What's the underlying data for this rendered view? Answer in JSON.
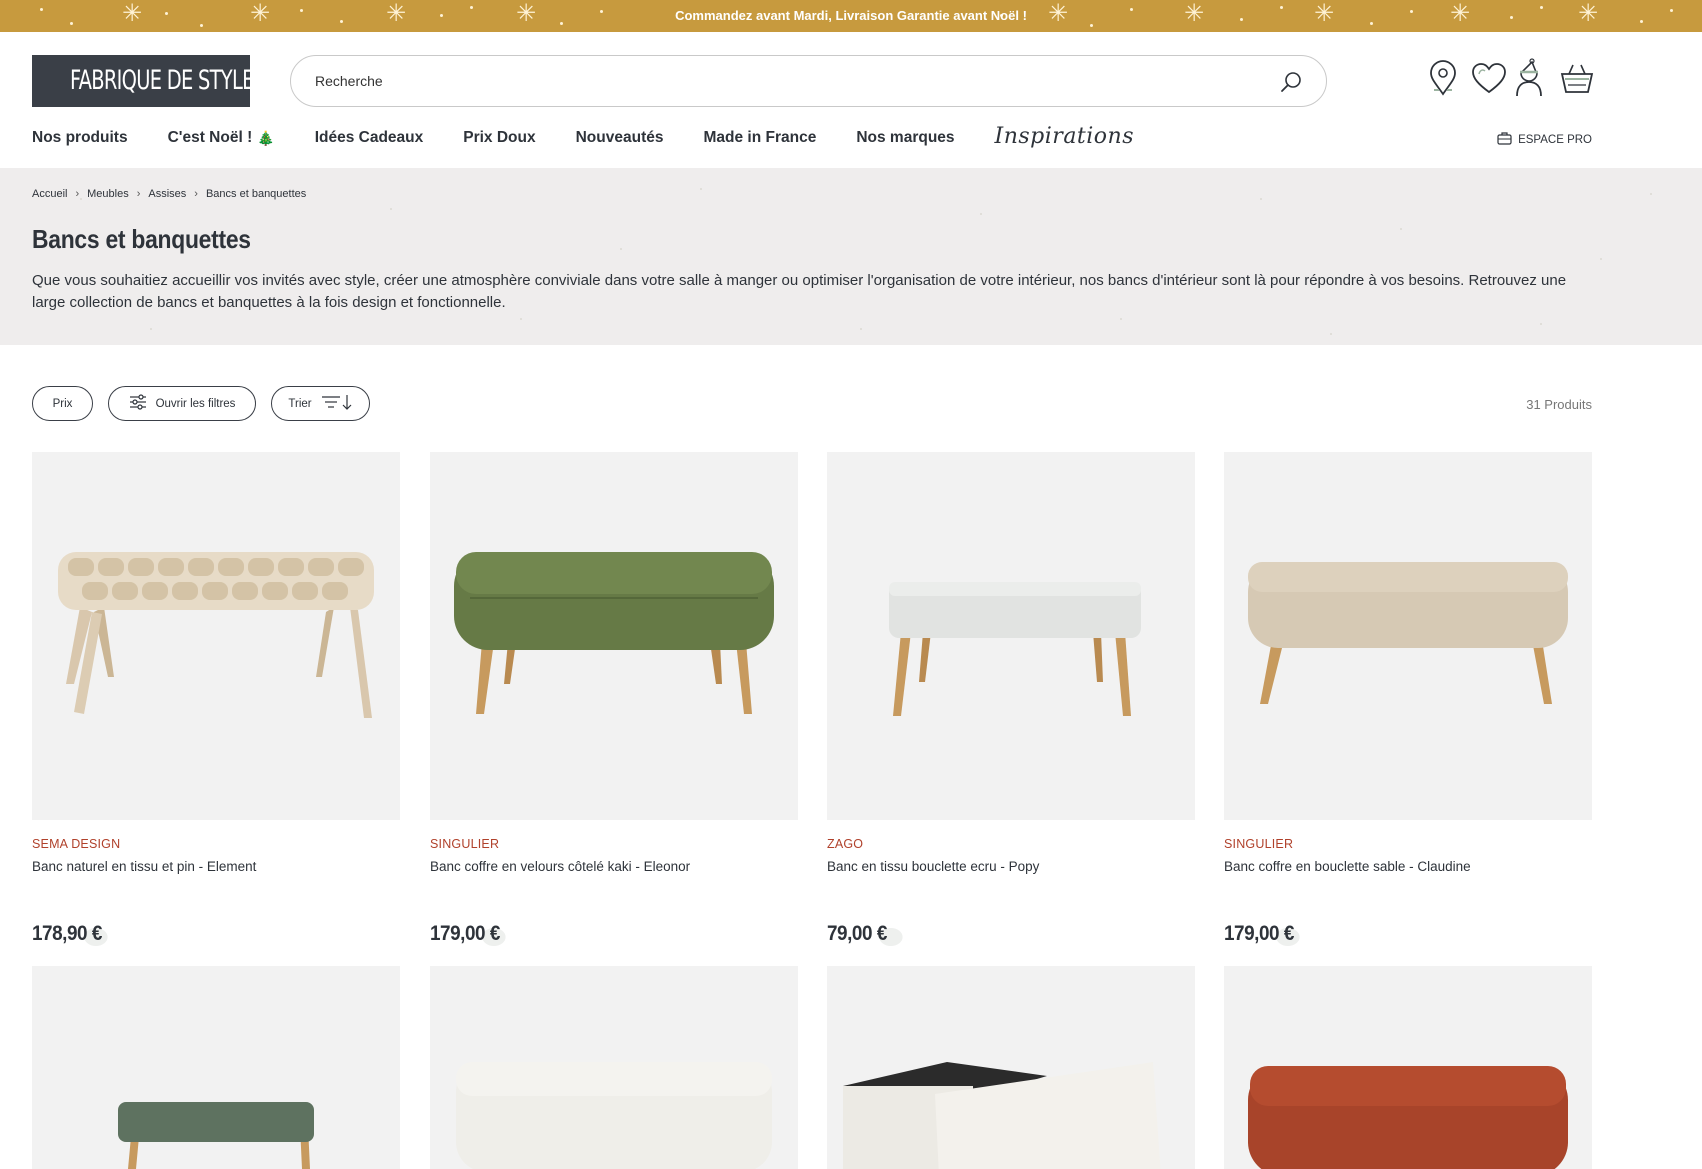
{
  "promo": {
    "text": "Commandez avant Mardi, Livraison Garantie avant Noël !"
  },
  "header": {
    "logo_text": "FABRIQUE DE STYLES",
    "search_placeholder": "Recherche",
    "icons": [
      "store-locator-icon",
      "wishlist-heart-icon",
      "account-icon",
      "basket-icon"
    ]
  },
  "nav": {
    "items": [
      "Nos produits",
      "C'est Noël !",
      "Idées Cadeaux",
      "Prix Doux",
      "Nouveautés",
      "Made in France",
      "Nos marques"
    ],
    "inspirations": "Inspirations",
    "pro_label": "ESPACE PRO"
  },
  "breadcrumb": [
    "Accueil",
    "Meubles",
    "Assises",
    "Bancs et banquettes"
  ],
  "page": {
    "title": "Bancs et banquettes",
    "description": "Que vous souhaitiez accueillir vos invités avec style, créer une atmosphère conviviale dans votre salle à manger ou optimiser l'organisation de votre intérieur, nos bancs d'intérieur sont là pour répondre à vos besoins. Retrouvez une large collection de bancs et banquettes à la fois design et fonctionnelle."
  },
  "filters": {
    "price_label": "Prix",
    "open_filters_label": "Ouvrir les filtres",
    "sort_label": "Trier",
    "count": "31 Produits"
  },
  "products": [
    {
      "brand": "SEMA DESIGN",
      "name": "Banc naturel en tissu et pin - Element",
      "price": "178,90 €"
    },
    {
      "brand": "SINGULIER",
      "name": "Banc coffre en velours côtelé kaki - Eleonor",
      "price": "179,00 €"
    },
    {
      "brand": "ZAGO",
      "name": "Banc en tissu bouclette ecru - Popy",
      "price": "79,00 €"
    },
    {
      "brand": "SINGULIER",
      "name": "Banc coffre en bouclette sable - Claudine",
      "price": "179,00 €"
    }
  ],
  "colors": {
    "promo_bg": "#c79a3e",
    "logo_bg": "#3a3f47",
    "brand_text": "#b0412b",
    "hero_bg": "#efeded"
  }
}
